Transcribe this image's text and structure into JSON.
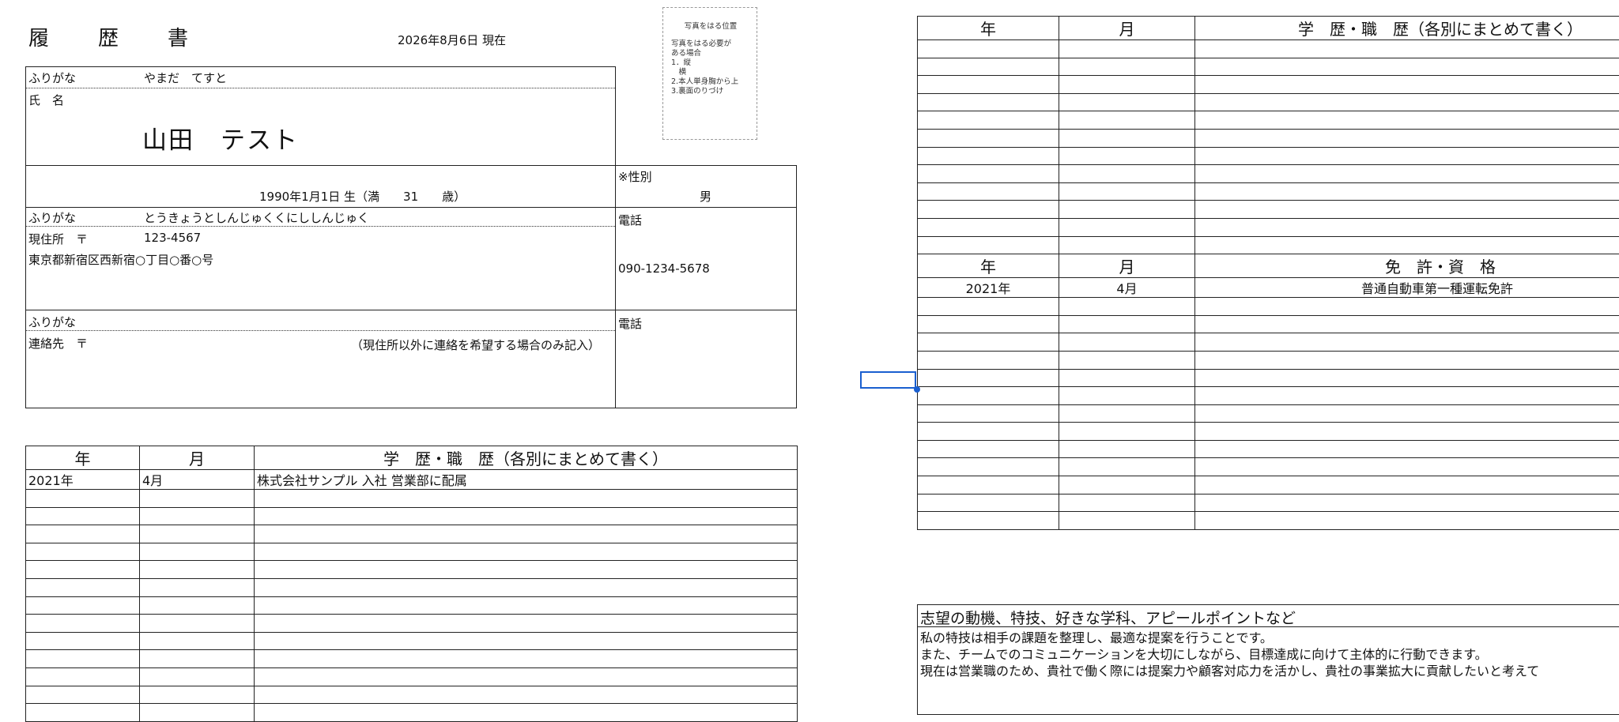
{
  "header": {
    "title": "履　歴　書",
    "date": "2026年8月6日 現在"
  },
  "photo": {
    "title": "写真をはる位置",
    "lines": [
      "写真をはる必要が",
      "ある場合",
      "1．縦",
      "　横",
      "2.本人単身胸から上",
      "3.裏面のりづけ"
    ]
  },
  "personal": {
    "furigana_label": "ふりがな",
    "furigana_value": "やまだ　てすと",
    "name_label": "氏　名",
    "name_value": "山田　テスト",
    "birth": "1990年1月1日 生（満　　31　　歳）",
    "gender_label": "※性別",
    "gender_value": "男"
  },
  "address": {
    "furigana_label": "ふりがな",
    "furigana_value": "とうきょうとしんじゅくくにししんじゅく",
    "label": "現住所　〒",
    "postal": "123-4567",
    "value": "東京都新宿区西新宿○丁目○番○号",
    "phone_label": "電話",
    "phone_value": "090-1234-5678"
  },
  "contact": {
    "furigana_label": "ふりがな",
    "label": "連絡先　〒",
    "note": "（現住所以外に連絡を希望する場合のみ記入）",
    "phone_label": "電話"
  },
  "history_left": {
    "headers": [
      "年",
      "月",
      "学　歴・職　歴（各別にまとめて書く）"
    ],
    "rows": [
      [
        "2021年",
        "4月",
        "株式会社サンプル 入社 営業部に配属"
      ]
    ]
  },
  "history_right": {
    "headers": [
      "年",
      "月",
      "学　歴・職　歴（各別にまとめて書く）"
    ]
  },
  "licenses": {
    "headers": [
      "年",
      "月",
      "免　許・資　格"
    ],
    "rows": [
      [
        "2021年",
        "4月",
        "普通自動車第一種運転免許"
      ]
    ]
  },
  "motivation": {
    "title": "志望の動機、特技、好きな学科、アピールポイントなど",
    "lines": [
      "私の特技は相手の課題を整理し、最適な提案を行うことです。",
      "また、チームでのコミュニケーションを大切にしながら、目標達成に向けて主体的に行動できます。",
      "現在は営業職のため、貴社で働く際には提案力や顧客対応力を活かし、貴社の事業拡大に貢献したいと考えて"
    ]
  },
  "colors": {
    "selection": "#1a5fd0",
    "border": "#222222"
  }
}
